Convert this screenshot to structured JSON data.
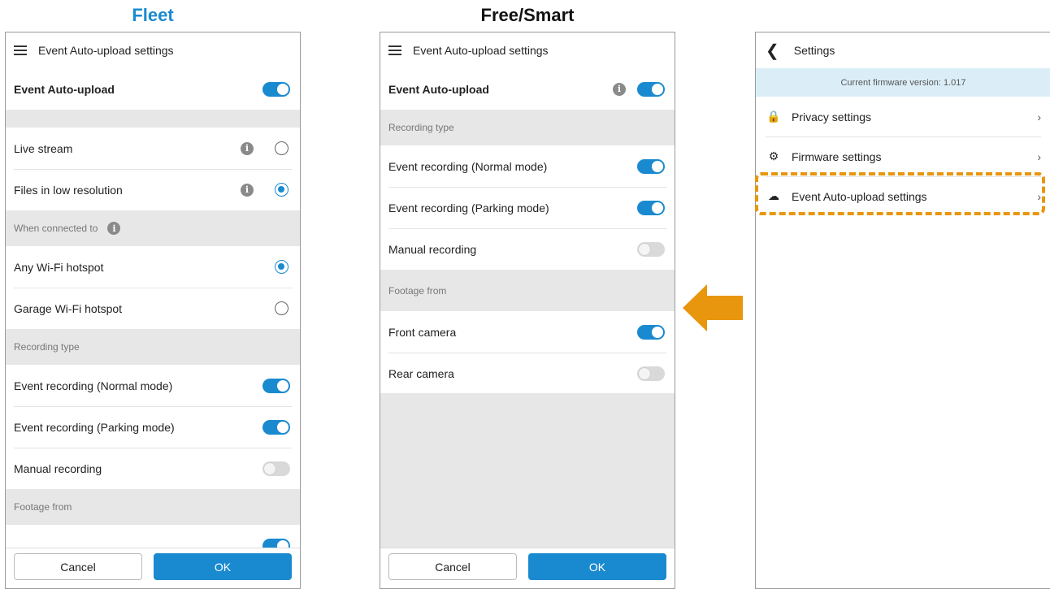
{
  "captions": {
    "fleet": "Fleet",
    "free_smart": "Free/Smart"
  },
  "fleet": {
    "title": "Event Auto-upload settings",
    "auto_upload_label": "Event Auto-upload",
    "live_stream": "Live stream",
    "low_res": "Files in low resolution",
    "connected_section": "When connected to",
    "any_wifi": "Any Wi-Fi hotspot",
    "garage_wifi": "Garage Wi-Fi hotspot",
    "recording_section": "Recording type",
    "event_normal": "Event recording (Normal mode)",
    "event_parking": "Event recording (Parking mode)",
    "manual": "Manual recording",
    "footage_section": "Footage from",
    "cancel": "Cancel",
    "ok": "OK"
  },
  "free": {
    "title": "Event Auto-upload settings",
    "auto_upload_label": "Event Auto-upload",
    "recording_section": "Recording type",
    "event_normal": "Event recording (Normal mode)",
    "event_parking": "Event recording (Parking mode)",
    "manual": "Manual recording",
    "footage_section": "Footage from",
    "front": "Front camera",
    "rear": "Rear camera",
    "cancel": "Cancel",
    "ok": "OK"
  },
  "settings": {
    "title": "Settings",
    "firmware_version": "Current firmware version: 1.017",
    "privacy": "Privacy settings",
    "firmware": "Firmware settings",
    "event_upload": "Event Auto-upload settings"
  },
  "colors": {
    "accent": "#1a8ad0",
    "highlight": "#e8960e"
  }
}
